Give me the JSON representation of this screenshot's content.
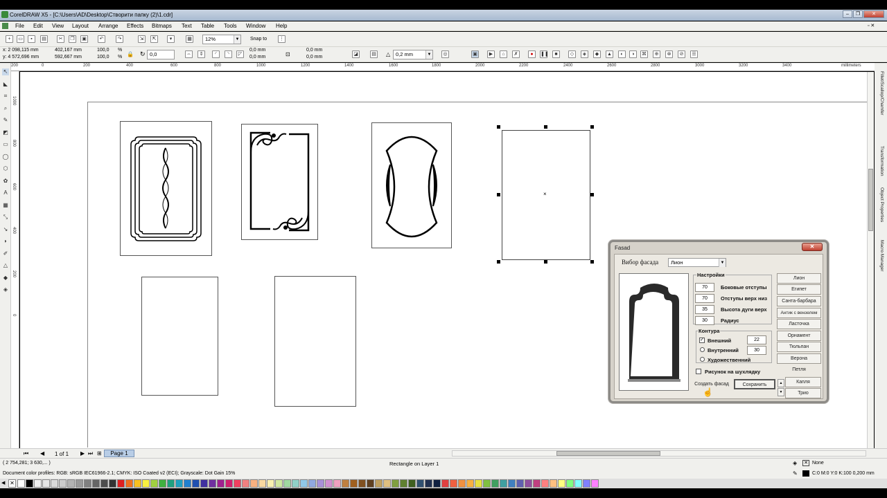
{
  "window": {
    "title": "CorelDRAW X5 - [C:\\Users\\AD\\Desktop\\Створити папку (2)\\1.cdr]",
    "min": "–",
    "restore": "❐",
    "close": "✕"
  },
  "menu": [
    "File",
    "Edit",
    "View",
    "Layout",
    "Arrange",
    "Effects",
    "Bitmaps",
    "Text",
    "Table",
    "Tools",
    "Window",
    "Help"
  ],
  "toolbar": {
    "zoom": "12%",
    "snap": "Snap to"
  },
  "propbar": {
    "x": "x: 2 098,115 mm",
    "y": "y: 4 572,696 mm",
    "w": "402,167 mm",
    "h": "592,667 mm",
    "sx": "100,0",
    "sy": "100,0",
    "pct": "%",
    "angle": "0,0",
    "c1": "0,0 mm",
    "c2": "0,0 mm",
    "c3": "0,0 mm",
    "c4": "0,0 mm",
    "outline": "0,2 mm"
  },
  "ruler": {
    "h": [
      "200",
      "0",
      "200",
      "400",
      "600",
      "800",
      "1000",
      "1200",
      "1400",
      "1600",
      "1800",
      "2000",
      "2200",
      "2400",
      "2600",
      "2800",
      "3000",
      "3200",
      "3400"
    ],
    "unit": "millimeters",
    "v": [
      "1000",
      "800",
      "600",
      "400",
      "200",
      "0"
    ]
  },
  "dialog": {
    "title": "Fasad",
    "close": "✕",
    "select_label": "Вибор фасада",
    "select_value": "Лион",
    "settings_group": "Настройки",
    "fields": [
      {
        "value": "70",
        "label": "Боковые отступы"
      },
      {
        "value": "70",
        "label": "Отступы верх низ"
      },
      {
        "value": "35",
        "label": "Высота дуги верх"
      },
      {
        "value": "30",
        "label": "Радиус"
      }
    ],
    "contour_group": "Контура",
    "contours": [
      {
        "label": "Внешний",
        "checked": true,
        "value": "22"
      },
      {
        "label": "Внутренний",
        "checked": false,
        "value": "30"
      },
      {
        "label": "Художественний",
        "checked": false
      }
    ],
    "drawer_label": "Рисунок на шухлядку",
    "create_btn": "Создать фасад",
    "save_btn": "Сохранить",
    "list": [
      "Лион",
      "Египет",
      "Санта-барбара",
      "Антик с вензелем",
      "Ласточка",
      "Орнамент",
      "Тюльпан",
      "Верона",
      "Петля",
      "Капля",
      "Трио"
    ],
    "scroll_up": "▲",
    "scroll_down": "▼"
  },
  "pages": {
    "counter": "1 of 1",
    "tab": "Page 1"
  },
  "status": {
    "coords": "( 2 754,281; 3 630,... )",
    "object": "Rectangle on Layer 1",
    "profiles": "Document color profiles: RGB: sRGB IEC61966-2.1; CMYK: ISO Coated v2 (ECI); Grayscale: Dot Gain 15%",
    "fill": "None",
    "outline": "C:0 M:0 Y:0 K:100  0,200 mm"
  },
  "dockers": [
    "Fillet/Scallop/Chamfer",
    "Transformation",
    "Object Properties",
    "Macro Manager"
  ],
  "palette": [
    "#ffffff",
    "#000000",
    "#f2f2f2",
    "#e6e6e6",
    "#d9d9d9",
    "#cccccc",
    "#b3b3b3",
    "#999999",
    "#808080",
    "#666666",
    "#4d4d4d",
    "#333333",
    "#e02020",
    "#f07020",
    "#f8c020",
    "#f8f040",
    "#a0d040",
    "#40b040",
    "#20a080",
    "#20a0c0",
    "#2080d0",
    "#2050b0",
    "#4030a0",
    "#7030a0",
    "#a02090",
    "#d02070",
    "#f04060",
    "#f08080",
    "#f8b080",
    "#f8d8a0",
    "#f8f0b0",
    "#d0e8a0",
    "#a0d8a0",
    "#90d0c8",
    "#90c8e8",
    "#90a8e0",
    "#a890d8",
    "#d090d0",
    "#f0a0c0",
    "#c08040",
    "#a06020",
    "#805020",
    "#604020",
    "#c0a060",
    "#e0c080",
    "#80a040",
    "#608030",
    "#406020",
    "#305070",
    "#203050",
    "#102040",
    "#e04040",
    "#f06040",
    "#f09040",
    "#f8b040",
    "#e8e040",
    "#80c040",
    "#40a060",
    "#40a0a0",
    "#4080c0",
    "#6060b0",
    "#9050a0",
    "#c04080",
    "#ff8080",
    "#ffc080",
    "#ffff80",
    "#80ff80",
    "#80ffff",
    "#8080ff",
    "#ff80ff"
  ]
}
